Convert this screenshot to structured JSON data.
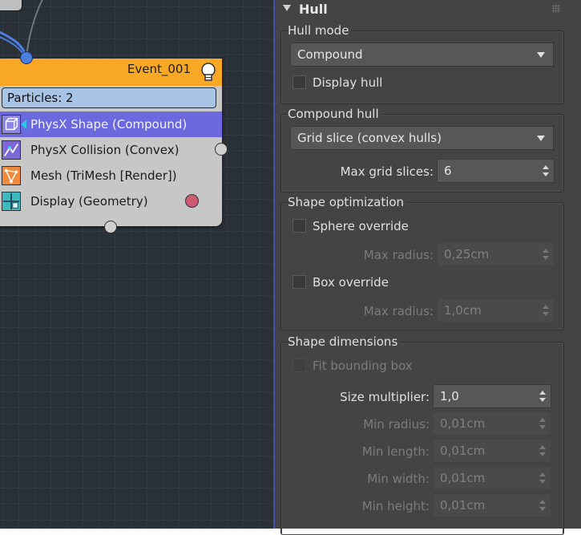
{
  "graph": {
    "node": {
      "title": "Event_001",
      "particles_label": "Particles: 2",
      "operators": [
        {
          "label": "PhysX Shape (Compound)",
          "selected": true
        },
        {
          "label": "PhysX Collision (Convex)",
          "selected": false
        },
        {
          "label": "Mesh (TriMesh [Render])",
          "selected": false
        },
        {
          "label": "Display (Geometry)",
          "selected": false
        }
      ]
    }
  },
  "panel": {
    "rollout_title": "Hull",
    "hull_mode": {
      "title": "Hull mode",
      "mode_value": "Compound",
      "display_hull_label": "Display hull",
      "display_hull_checked": false
    },
    "compound_hull": {
      "title": "Compound hull",
      "method_value": "Grid slice (convex hulls)",
      "max_grid_slices_label": "Max grid slices:",
      "max_grid_slices_value": "6"
    },
    "shape_optimization": {
      "title": "Shape optimization",
      "sphere_override_label": "Sphere override",
      "sphere_max_radius_label": "Max radius:",
      "sphere_max_radius_value": "0,25cm",
      "box_override_label": "Box override",
      "box_max_radius_label": "Max radius:",
      "box_max_radius_value": "1,0cm"
    },
    "shape_dimensions": {
      "title": "Shape dimensions",
      "fit_bounding_box_label": "Fit bounding box",
      "size_multiplier_label": "Size multiplier:",
      "size_multiplier_value": "1,0",
      "min_radius_label": "Min radius:",
      "min_radius_value": "0,01cm",
      "min_length_label": "Min length:",
      "min_length_value": "0,01cm",
      "min_width_label": "Min width:",
      "min_width_value": "0,01cm",
      "min_height_label": "Min height:",
      "min_height_value": "0,01cm"
    }
  },
  "colors": {
    "node_header": "#f9a826",
    "selected_row": "#6c68de",
    "wire": "#4b7fe0",
    "panel_bg": "#444444"
  }
}
